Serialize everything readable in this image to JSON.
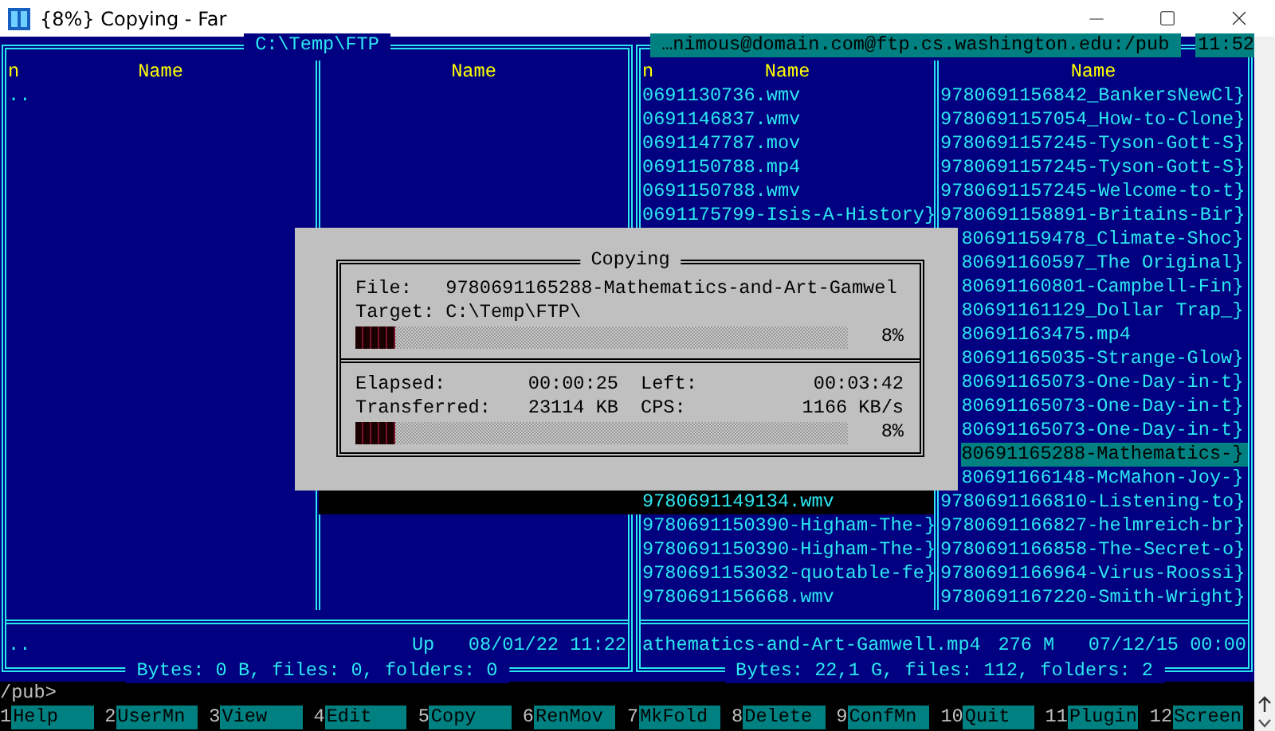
{
  "window": {
    "title": "{8%} Copying - Far"
  },
  "left_panel": {
    "active": false,
    "path": "C:\\Temp\\FTP",
    "sort_indicator": "n",
    "headings": [
      "Name",
      "Name"
    ],
    "rows": [
      {
        "left": {
          "text": "..",
          "selected": false
        }
      }
    ],
    "info": {
      "name": "..",
      "size": "Up",
      "date": "08/01/22 11:22"
    },
    "summary": "Bytes: 0 B, files: 0, folders: 0"
  },
  "right_panel": {
    "active": true,
    "path": "…nimous@domain.com@ftp.cs.washington.edu:/pub",
    "clock": "11:52",
    "sort_indicator": "n",
    "headings": [
      "Name",
      "Name"
    ],
    "rows": [
      {
        "left": {
          "text": "0691130736.wmv",
          "selected": false
        },
        "right": {
          "text": "9780691156842_BankersNewCl}",
          "selected": false,
          "partly_hidden": false
        }
      },
      {
        "left": {
          "text": "0691146837.wmv",
          "selected": false
        },
        "right": {
          "text": "9780691157054_How-to-Clone}",
          "selected": false,
          "partly_hidden": false
        }
      },
      {
        "left": {
          "text": "0691147787.mov",
          "selected": false
        },
        "right": {
          "text": "9780691157245-Tyson-Gott-S}",
          "selected": false,
          "partly_hidden": false
        }
      },
      {
        "left": {
          "text": "0691150788.mp4",
          "selected": false
        },
        "right": {
          "text": "9780691157245-Tyson-Gott-S}",
          "selected": false,
          "partly_hidden": false
        }
      },
      {
        "left": {
          "text": "0691150788.wmv",
          "selected": false
        },
        "right": {
          "text": "9780691157245-Welcome-to-t}",
          "selected": false,
          "partly_hidden": false
        }
      },
      {
        "left": {
          "text": "0691175799-Isis-A-History}",
          "selected": false
        },
        "right": {
          "text": "9780691158891-Britains-Bir}",
          "selected": false,
          "partly_hidden": false
        }
      },
      {
        "right": {
          "text": "80691159478_Climate-Shoc}",
          "selected": false,
          "partly_hidden": true
        }
      },
      {
        "right": {
          "text": "80691160597_The Original}",
          "selected": false,
          "partly_hidden": true
        }
      },
      {
        "right": {
          "text": "80691160801-Campbell-Fin}",
          "selected": false,
          "partly_hidden": true
        }
      },
      {
        "right": {
          "text": "80691161129_Dollar Trap_}",
          "selected": false,
          "partly_hidden": true
        }
      },
      {
        "right": {
          "text": "80691163475.mp4",
          "selected": false,
          "partly_hidden": true
        }
      },
      {
        "right": {
          "text": "80691165035-Strange-Glow}",
          "selected": false,
          "partly_hidden": true
        }
      },
      {
        "right": {
          "text": "80691165073-One-Day-in-t}",
          "selected": false,
          "partly_hidden": true
        }
      },
      {
        "right": {
          "text": "80691165073-One-Day-in-t}",
          "selected": false,
          "partly_hidden": true
        }
      },
      {
        "right": {
          "text": "80691165073-One-Day-in-t}",
          "selected": false,
          "partly_hidden": true
        }
      },
      {
        "right": {
          "text": "80691165288-Mathematics-}",
          "selected": true,
          "partly_hidden": true
        }
      },
      {
        "right": {
          "text": "80691166148-McMahon-Joy-}",
          "selected": false,
          "partly_hidden": true
        }
      },
      {
        "left": {
          "text": "9780691149134.wmv",
          "selected": false
        },
        "right": {
          "text": "9780691166810-Listening-to}",
          "selected": false,
          "partly_hidden": false
        }
      },
      {
        "left": {
          "text": "9780691150390-Higham-The-}",
          "selected": false
        },
        "right": {
          "text": "9780691166827-helmreich-br}",
          "selected": false,
          "partly_hidden": false
        }
      },
      {
        "left": {
          "text": "9780691150390-Higham-The-}",
          "selected": false
        },
        "right": {
          "text": "9780691166858-The-Secret-o}",
          "selected": false,
          "partly_hidden": false
        }
      },
      {
        "left": {
          "text": "9780691153032-quotable-fe}",
          "selected": false
        },
        "right": {
          "text": "9780691166964-Virus-Roossi}",
          "selected": false,
          "partly_hidden": false
        }
      },
      {
        "left": {
          "text": "9780691156668.wmv",
          "selected": false
        },
        "right": {
          "text": "9780691167220-Smith-Wright}",
          "selected": false,
          "partly_hidden": false
        }
      }
    ],
    "info": {
      "name": "athematics-and-Art-Gamwell.mp4",
      "size": "276 M",
      "date": "07/12/15 00:00"
    },
    "summary": "Bytes: 22,1 G, files: 112, folders: 2"
  },
  "copy_dialog": {
    "title": "Copying",
    "file_label": "File:",
    "file": "9780691165288-Mathematics-and-Art-Gamwel",
    "target_label": "Target:",
    "target": "C:\\Temp\\FTP\\",
    "file_progress": {
      "level": 0.08,
      "percent": "8%"
    },
    "stats": [
      {
        "label": "Elapsed:",
        "value": "00:00:25"
      },
      {
        "label": "Left:",
        "value": "00:03:42"
      },
      {
        "label": "Transferred:",
        "value": "23114 KB"
      },
      {
        "label": "CPS:",
        "value": "1166 KB/s"
      }
    ],
    "total_progress": {
      "level": 0.08,
      "percent": "8%"
    }
  },
  "command_line": "/pub>",
  "key_bar": [
    {
      "key": "1",
      "label": "Help"
    },
    {
      "key": "2",
      "label": "UserMn"
    },
    {
      "key": "3",
      "label": "View"
    },
    {
      "key": "4",
      "label": "Edit"
    },
    {
      "key": "5",
      "label": "Copy"
    },
    {
      "key": "6",
      "label": "RenMov"
    },
    {
      "key": "7",
      "label": "MkFold"
    },
    {
      "key": "8",
      "label": "Delete"
    },
    {
      "key": "9",
      "label": "ConfMn"
    },
    {
      "key": "10",
      "label": "Quit"
    },
    {
      "key": "11",
      "label": "Plugin"
    },
    {
      "key": "12",
      "label": "Screen"
    }
  ]
}
